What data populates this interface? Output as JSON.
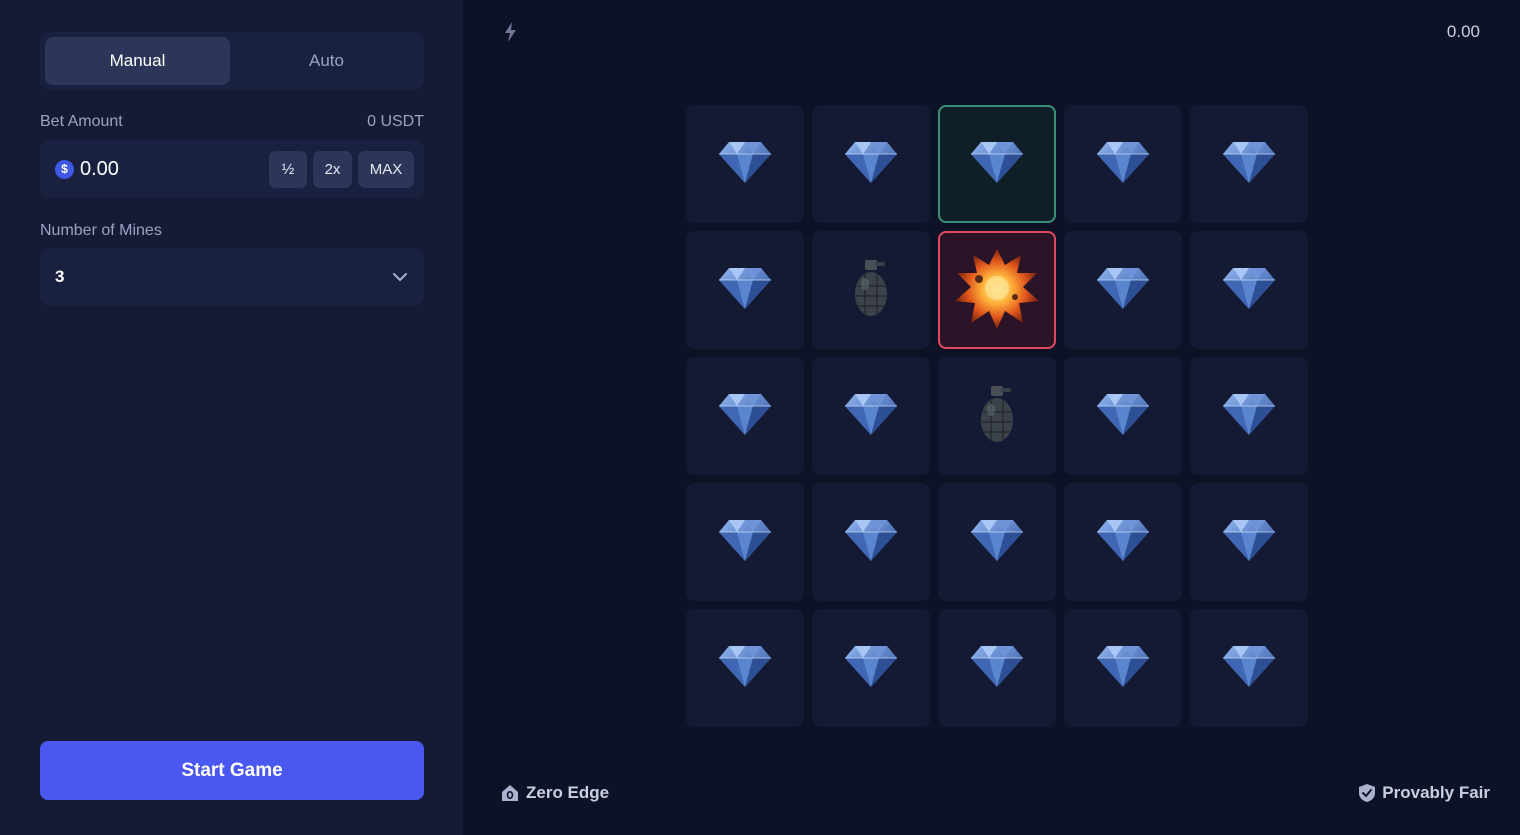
{
  "sidebar": {
    "tabs": [
      {
        "label": "Manual",
        "active": true
      },
      {
        "label": "Auto",
        "active": false
      }
    ],
    "bet": {
      "label": "Bet Amount",
      "currency_balance": "0 USDT",
      "value": "0.00",
      "coin_symbol": "$",
      "buttons": {
        "half": "½",
        "double": "2x",
        "max": "MAX"
      }
    },
    "mines": {
      "label": "Number of Mines",
      "value": "3"
    },
    "start_label": "Start Game"
  },
  "header": {
    "balance": "0.00"
  },
  "board": {
    "rows": 5,
    "cols": 5,
    "tiles": [
      "gem",
      "gem",
      "gem",
      "gem",
      "gem",
      "gem",
      "mine",
      "explosion",
      "gem",
      "gem",
      "gem",
      "gem",
      "mine",
      "gem",
      "gem",
      "gem",
      "gem",
      "gem",
      "gem",
      "gem",
      "gem",
      "gem",
      "gem",
      "gem",
      "gem"
    ],
    "selected_index": 2,
    "exploded_index": 7
  },
  "footer": {
    "left": "Zero Edge",
    "right": "Provably Fair"
  },
  "colors": {
    "accent": "#4a57f0",
    "selected_border": "#3a8f75",
    "explode_border": "#e0485d"
  }
}
